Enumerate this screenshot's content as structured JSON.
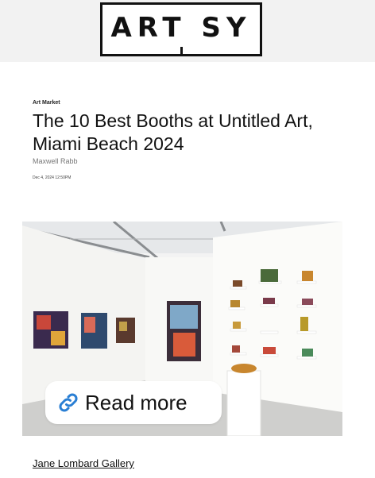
{
  "header": {
    "logo_text": "ART SY"
  },
  "article": {
    "category": "Art Market",
    "title": "The 10 Best Booths at Untitled Art, Miami Beach 2024",
    "author": "Maxwell Rabb",
    "date": "Dec 4, 2024 12:50PM"
  },
  "hero": {
    "read_more_label": "Read more",
    "read_more_icon": "link-icon",
    "colors": {
      "wall": "#f7f7f5",
      "floor": "#cfcfcd",
      "link_icon": "#2a7fd4"
    }
  },
  "footer": {
    "gallery_link": "Jane Lombard Gallery"
  }
}
